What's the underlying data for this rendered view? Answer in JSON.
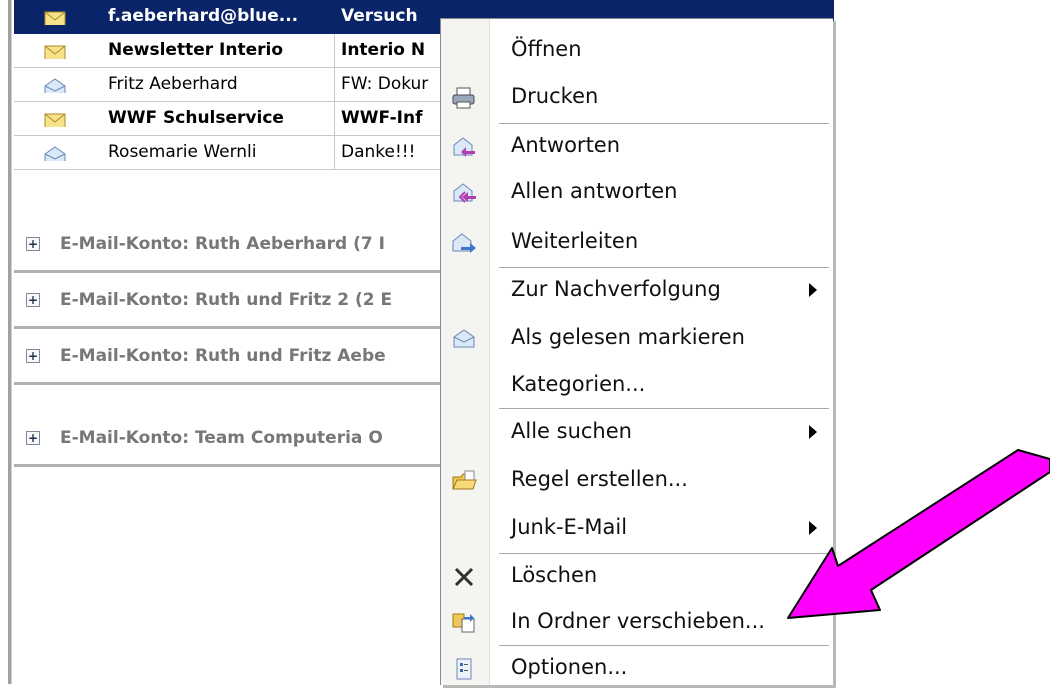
{
  "messages": [
    {
      "from": "f.aeberhard@blue...",
      "subject": "Versuch",
      "icon": "envelope-closed-icon",
      "state": "selected"
    },
    {
      "from": "Newsletter Interio",
      "subject": "Interio N",
      "icon": "envelope-closed-icon",
      "state": "unread"
    },
    {
      "from": "Fritz Aeberhard",
      "subject": "FW: Dokur",
      "icon": "envelope-open-icon",
      "state": "read"
    },
    {
      "from": "WWF Schulservice",
      "subject": "WWF-Inf",
      "icon": "envelope-closed-icon",
      "state": "unread"
    },
    {
      "from": "Rosemarie Wernli",
      "subject": "Danke!!!",
      "icon": "envelope-open-icon",
      "state": "read"
    }
  ],
  "groups": [
    {
      "expand": "+",
      "label": "E-Mail-Konto: Ruth Aeberhard (7 I"
    },
    {
      "expand": "+",
      "label": "E-Mail-Konto: Ruth und Fritz 2 (2 E"
    },
    {
      "expand": "+",
      "label": "E-Mail-Konto: Ruth und Fritz Aebe"
    },
    {
      "expand": "+",
      "label": "E-Mail-Konto: Team Computeria O"
    }
  ],
  "context_menu": {
    "items": [
      {
        "label": "Öffnen",
        "icon": ""
      },
      {
        "label": "Drucken",
        "icon": "printer-icon"
      },
      {
        "label": "Antworten",
        "icon": "reply-icon"
      },
      {
        "label": "Allen antworten",
        "icon": "reply-all-icon"
      },
      {
        "label": "Weiterleiten",
        "icon": "forward-icon"
      },
      {
        "label": "Zur Nachverfolgung",
        "icon": "",
        "submenu": true
      },
      {
        "label": "Als gelesen markieren",
        "icon": "mark-read-icon"
      },
      {
        "label": "Kategorien...",
        "icon": ""
      },
      {
        "label": "Alle suchen",
        "icon": "",
        "submenu": true
      },
      {
        "label": "Regel erstellen...",
        "icon": "rule-folder-icon"
      },
      {
        "label": "Junk-E-Mail",
        "icon": "",
        "submenu": true
      },
      {
        "label": "Löschen",
        "icon": "delete-x-icon"
      },
      {
        "label": "In Ordner verschieben...",
        "icon": "move-to-folder-icon"
      },
      {
        "label": "Optionen...",
        "icon": "options-icon"
      }
    ]
  },
  "colors": {
    "selection": "#0a246a",
    "annotation_arrow": "#ff00ff"
  }
}
